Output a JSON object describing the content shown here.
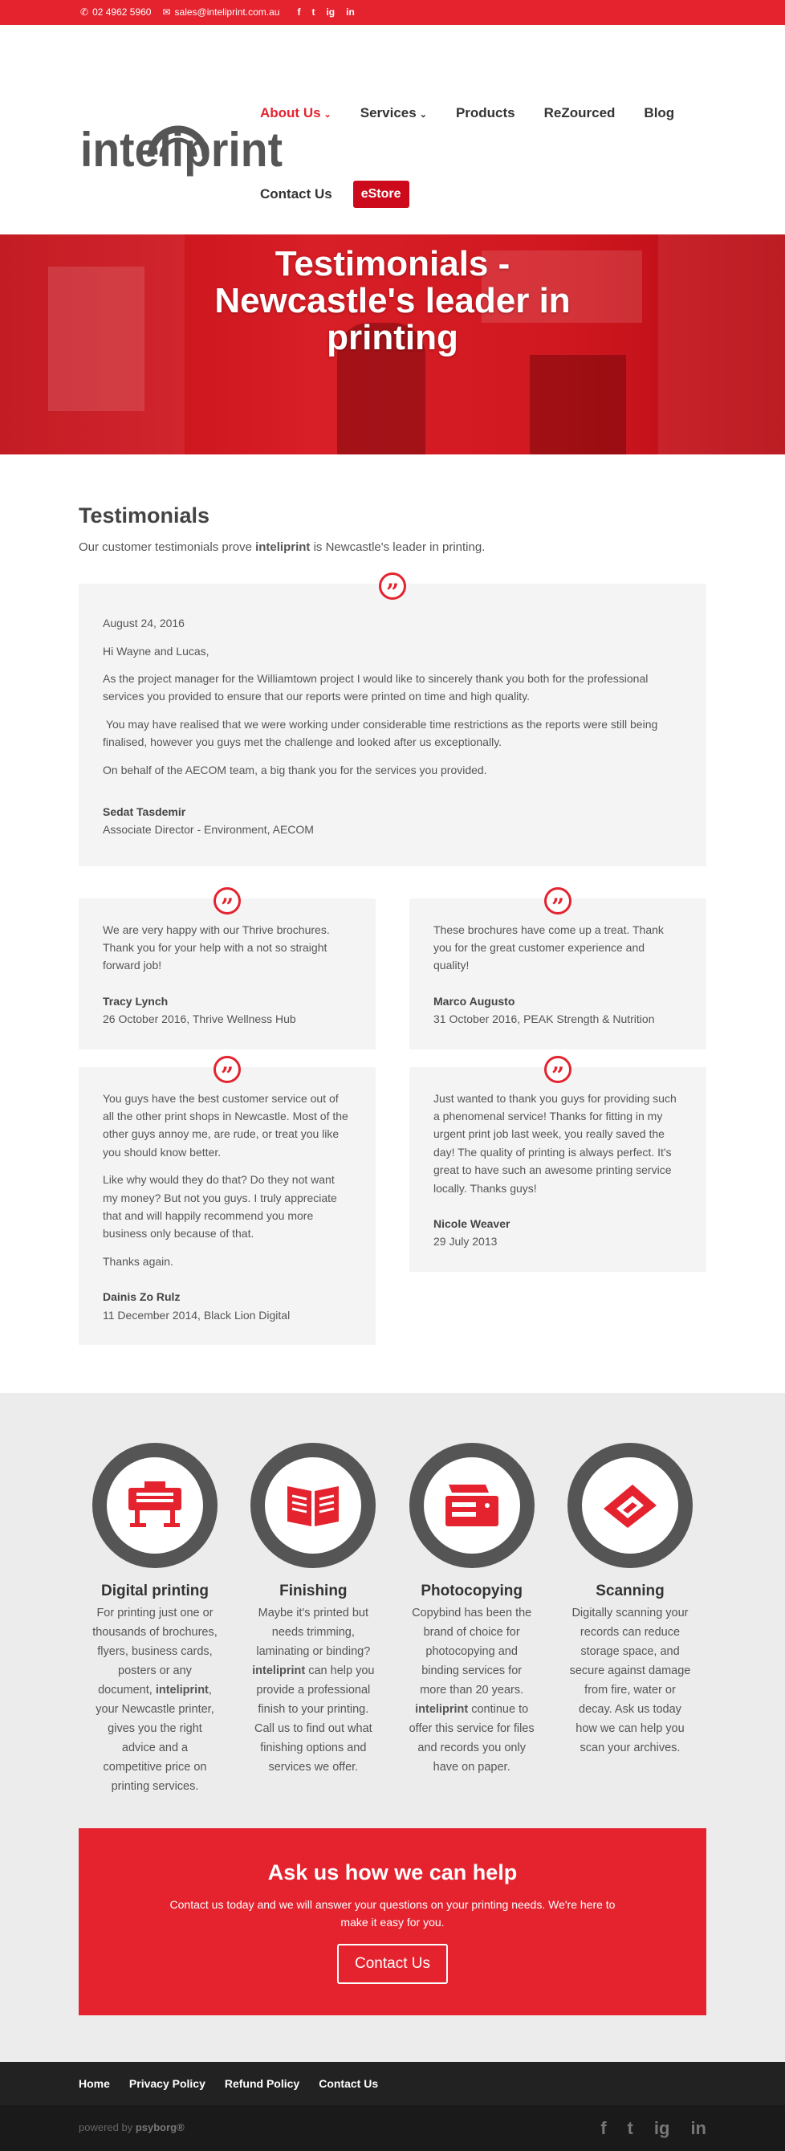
{
  "topbar": {
    "phone": "02 4962 5960",
    "email": "sales@inteliprint.com.au",
    "social": [
      "f",
      "t",
      "ig",
      "in"
    ]
  },
  "header": {
    "logo_text": "inteliprint",
    "nav": [
      {
        "label": "About Us",
        "has_caret": true,
        "active": true
      },
      {
        "label": "Services",
        "has_caret": true,
        "active": false
      },
      {
        "label": "Products",
        "has_caret": false,
        "active": false
      },
      {
        "label": "ReZourced",
        "has_caret": false,
        "active": false
      },
      {
        "label": "Blog",
        "has_caret": false,
        "active": false
      }
    ],
    "nav2_contact": "Contact Us",
    "estore": "eStore"
  },
  "hero": {
    "line1": "Testimonials -",
    "line2": "Newcastle's leader in",
    "line3": "printing"
  },
  "testimonials": {
    "heading": "Testimonials",
    "intro_before": "Our customer testimonials prove ",
    "intro_brand": "inteliprint",
    "intro_after": " is Newcastle's leader in printing.",
    "featured": {
      "date": "August 24, 2016",
      "greeting": "Hi Wayne and Lucas,",
      "p1": "As the project manager for the Williamtown project I would like to sincerely thank you both for the professional services you provided to ensure that our reports were printed on time and high quality.",
      "p2": " You may have realised that we were working under considerable time restrictions as the reports were still being finalised, however you guys met the challenge and looked after us exceptionally.",
      "p3": "On behalf of the AECOM team, a big thank you for the services you provided.",
      "author": "Sedat Tasdemir",
      "role": "Associate Director - Environment, AECOM"
    },
    "left": [
      {
        "paras": [
          "We are very happy with our Thrive brochures. Thank you for your help with a not so straight forward job!"
        ],
        "author": "Tracy Lynch",
        "meta": "26 October 2016, Thrive Wellness Hub"
      },
      {
        "paras": [
          "You guys have the best customer service out of all the other print shops in Newcastle. Most of the other guys annoy me, are rude, or treat you like you should know better.",
          "Like why would they do that? Do they not want my money? But not you guys. I truly appreciate that and will happily recommend you more business only because of that.",
          "Thanks again."
        ],
        "author": "Dainis Zo Rulz",
        "meta": "11 December 2014, Black Lion Digital"
      }
    ],
    "right": [
      {
        "paras": [
          "These brochures have come up a treat. Thank you for the great customer experience and quality!"
        ],
        "author": "Marco Augusto",
        "meta": "31 October 2016, PEAK Strength & Nutrition"
      },
      {
        "paras": [
          "Just wanted to thank you guys for providing such a phenomenal service! Thanks for fitting in my urgent print job last week, you really saved the day! The quality of printing is always perfect. It's great to have such an awesome printing service locally. Thanks guys!"
        ],
        "author": "Nicole Weaver",
        "meta": "29 July 2013"
      }
    ]
  },
  "services": [
    {
      "icon": "printer-icon",
      "title": "Digital printing",
      "desc_html": "For printing just one or thousands of brochures, flyers, business cards, posters or any document, <b>inteliprint</b>, your Newcastle printer, gives you the right advice and a competitive price on printing services."
    },
    {
      "icon": "open-book-icon",
      "title": "Finishing",
      "desc_html": "Maybe it's printed but needs trimming, laminating or binding? <b>inteliprint</b> can help you provide a professional finish to your printing. Call us to find out what finishing options and services we offer."
    },
    {
      "icon": "photocopier-icon",
      "title": "Photocopying",
      "desc_html": "Copybind has been the brand of choice for photocopying and binding services for more than 20 years. <b>inteliprint</b> continue to offer this service for files and records you only have on paper."
    },
    {
      "icon": "scanner-icon",
      "title": "Scanning",
      "desc_html": "Digitally scanning your records can reduce storage space, and secure against damage from fire, water or decay. Ask us today how we can help you scan your archives."
    }
  ],
  "cta": {
    "heading": "Ask us how we can help",
    "sub": "Contact us today and we will answer your questions on your printing needs. We're here to make it easy for you.",
    "button": "Contact Us"
  },
  "footer": {
    "links": [
      "Home",
      "Privacy Policy",
      "Refund Policy",
      "Contact Us"
    ],
    "powered_prefix": "powered by ",
    "powered_brand": "psyborg®",
    "social": [
      "f",
      "t",
      "ig",
      "in"
    ]
  },
  "colors": {
    "brand_red": "#e4232f",
    "dark_gray": "#555555",
    "light_gray": "#f4f4f4"
  }
}
